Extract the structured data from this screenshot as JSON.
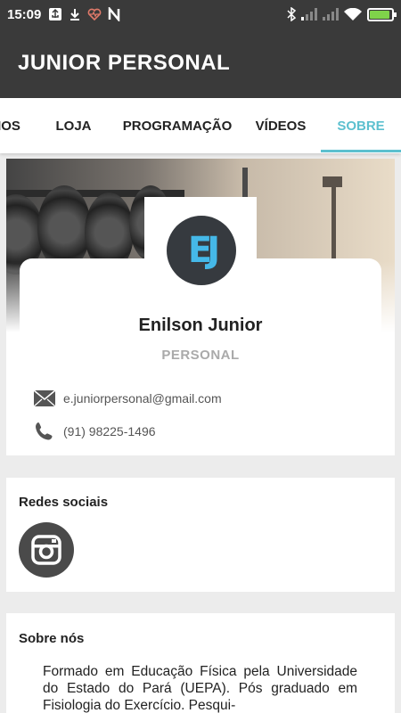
{
  "status_bar": {
    "time": "15:09",
    "left_icons": [
      "usb-icon",
      "download-icon",
      "heart-rate-icon",
      "n-app-icon"
    ],
    "right_icons": [
      "bluetooth-icon",
      "signal-icon",
      "signal-icon",
      "wifi-icon",
      "battery-icon"
    ],
    "battery_level": 0.8,
    "battery_color": "#7fd34a"
  },
  "app": {
    "title": "JUNIOR PERSONAL"
  },
  "tabs": [
    {
      "label": "IOS"
    },
    {
      "label": "LOJA"
    },
    {
      "label": "PROGRAMAÇÃO"
    },
    {
      "label": "VÍDEOS"
    },
    {
      "label": "SOBRE",
      "active": true
    }
  ],
  "accent_color": "#5cc0cf",
  "profile": {
    "logo_text": "EJ",
    "name": "Enilson Junior",
    "role": "PERSONAL",
    "email": "e.juniorpersonal@gmail.com",
    "phone": "(91) 98225-1496"
  },
  "social": {
    "title": "Redes sociais",
    "items": [
      {
        "icon": "instagram-icon"
      }
    ]
  },
  "about": {
    "title": "Sobre nós",
    "text": "Formado em Educação Física pela Universidade do Estado do Pará (UEPA). Pós graduado em Fisiologia do Exercício. Pesqui-"
  }
}
